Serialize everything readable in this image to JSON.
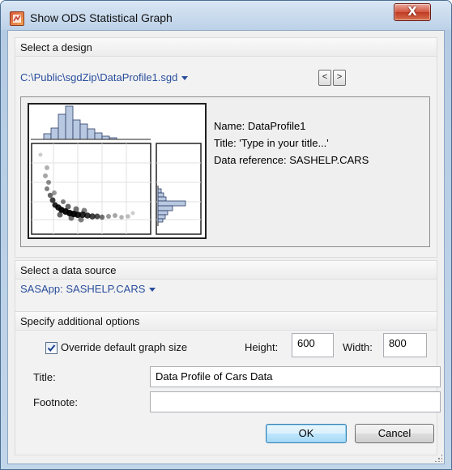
{
  "window": {
    "title": "Show ODS Statistical Graph",
    "close_glyph": "X"
  },
  "design": {
    "section_label": "Select a design",
    "file_path": "C:\\Public\\sgdZip\\DataProfile1.sgd",
    "prev_glyph": "<",
    "next_glyph": ">",
    "info": {
      "name": "Name: DataProfile1",
      "title": "Title: 'Type in your title...'",
      "data_reference": "Data reference: SASHELP.CARS"
    }
  },
  "source": {
    "section_label": "Select a data source",
    "value": "SASApp: SASHELP.CARS"
  },
  "options": {
    "section_label": "Specify additional options",
    "override_label": "Override default graph size",
    "override_checked": true,
    "height_label": "Height:",
    "height_value": "600",
    "width_label": "Width:",
    "width_value": "800",
    "title_label": "Title:",
    "title_value": "Data Profile of Cars Data",
    "footnote_label": "Footnote:",
    "footnote_value": ""
  },
  "buttons": {
    "ok": "OK",
    "cancel": "Cancel"
  },
  "colors": {
    "link": "#2a4e9c",
    "histogram_fill": "#b8c8e0",
    "histogram_stroke": "#2c3e66"
  },
  "icons": [
    "app-icon",
    "close-icon",
    "dropdown-caret-icon",
    "checkmark-icon",
    "size-grip-icon"
  ]
}
